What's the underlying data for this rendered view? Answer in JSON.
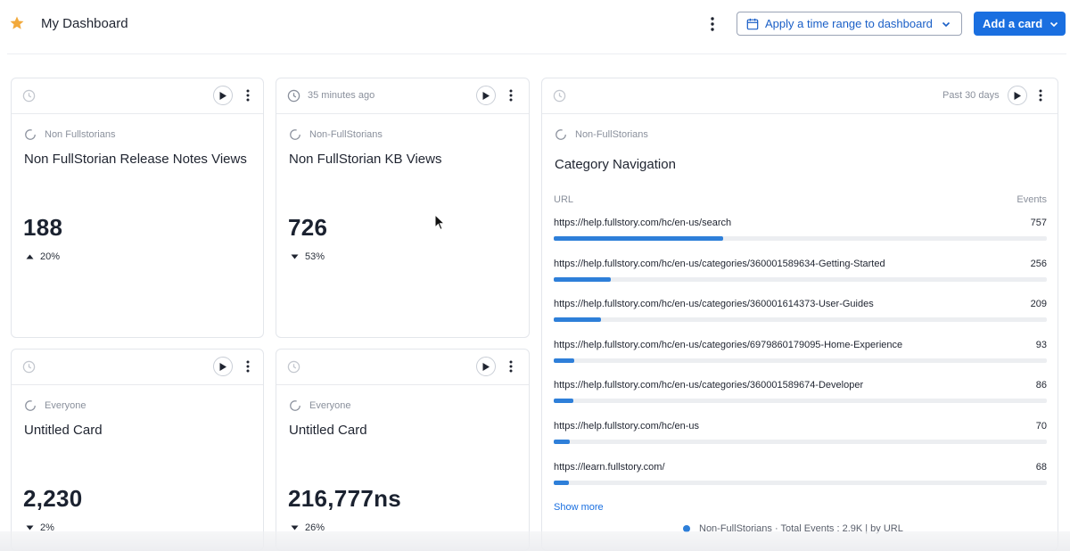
{
  "header": {
    "title": "My Dashboard",
    "time_range_button": "Apply a time range to dashboard",
    "add_card_button": "Add a card"
  },
  "cards": [
    {
      "updated": "",
      "segment": "Non Fullstorians",
      "title": "Non FullStorian Release Notes Views",
      "metric": "188",
      "delta": "20%",
      "delta_direction": "up"
    },
    {
      "updated": "35 minutes ago",
      "segment": "Non-FullStorians",
      "title": "Non FullStorian KB Views",
      "metric": "726",
      "delta": "53%",
      "delta_direction": "down"
    },
    {
      "updated": "",
      "segment": "Everyone",
      "title": "Untitled Card",
      "metric": "2,230",
      "delta": "2%",
      "delta_direction": "down"
    },
    {
      "updated": "",
      "segment": "Everyone",
      "title": "Untitled Card",
      "metric": "216,777ns",
      "delta": "26%",
      "delta_direction": "down"
    }
  ],
  "category_card": {
    "range": "Past 30 days",
    "segment": "Non-FullStorians",
    "title": "Category Navigation",
    "col_url": "URL",
    "col_events": "Events",
    "rows": [
      {
        "url": "https://help.fullstory.com/hc/en-us/search",
        "events": 757
      },
      {
        "url": "https://help.fullstory.com/hc/en-us/categories/360001589634-Getting-Started",
        "events": 256
      },
      {
        "url": "https://help.fullstory.com/hc/en-us/categories/360001614373-User-Guides",
        "events": 209
      },
      {
        "url": "https://help.fullstory.com/hc/en-us/categories/6979860179095-Home-Experience",
        "events": 93
      },
      {
        "url": "https://help.fullstory.com/hc/en-us/categories/360001589674-Developer",
        "events": 86
      },
      {
        "url": "https://help.fullstory.com/hc/en-us",
        "events": 70
      },
      {
        "url": "https://learn.fullstory.com/",
        "events": 68
      }
    ],
    "bar_max": 2200,
    "show_more": "Show more",
    "legend": "Non-FullStorians · Total Events : 2.9K | by URL"
  },
  "colors": {
    "accent": "#1a6fe0",
    "bar": "#2e7fd9",
    "star": "#f2a93b"
  },
  "icons": [
    "star-icon",
    "kebab-icon",
    "calendar-icon",
    "chevron-down-icon",
    "clock-icon",
    "play-icon",
    "segment-icon",
    "caret-up-icon",
    "caret-down-icon",
    "cursor-icon"
  ]
}
